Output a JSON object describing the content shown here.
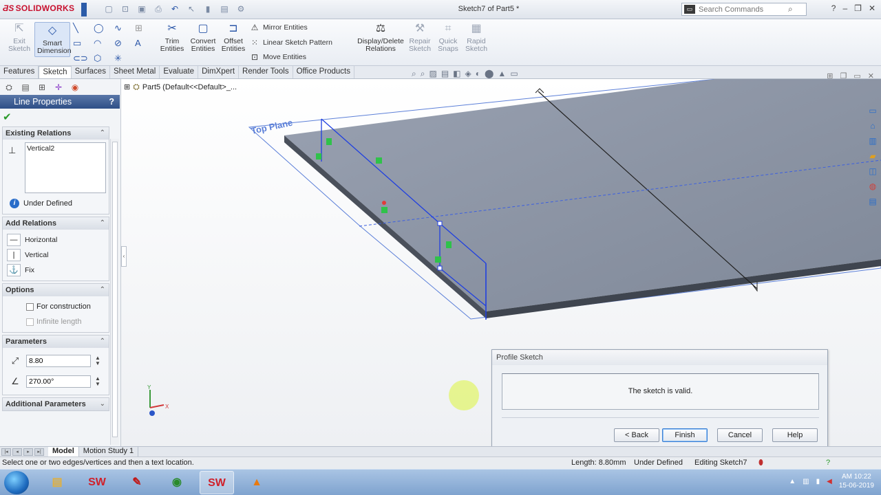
{
  "app": {
    "brand": "SOLIDWORKS",
    "document_title": "Sketch7 of Part5 *",
    "search_placeholder": "Search Commands",
    "colors": {
      "accent": "#2a56a8",
      "brand": "#c8102e",
      "sketch": "#1f3fe0",
      "plate": "#8d96a6"
    }
  },
  "toolbar": {
    "exit_sketch": "Exit Sketch",
    "smart_dimension": "Smart Dimension",
    "trim_entities": "Trim Entities",
    "convert_entities": "Convert Entities",
    "offset_entities": "Offset Entities",
    "mirror_entities": "Mirror Entities",
    "linear_sketch_pattern": "Linear Sketch Pattern",
    "move_entities": "Move Entities",
    "display_delete_relations": "Display/Delete Relations",
    "repair_sketch": "Repair Sketch",
    "quick_snaps": "Quick Snaps",
    "rapid_sketch": "Rapid Sketch"
  },
  "tabs": [
    "Features",
    "Sketch",
    "Surfaces",
    "Sheet Metal",
    "Evaluate",
    "DimXpert",
    "Render Tools",
    "Office Products"
  ],
  "active_tab": "Sketch",
  "tree": {
    "part_label": "Part5  (Default<<Default>_..."
  },
  "property_manager": {
    "title": "Line Properties",
    "help": "?",
    "existing_relations": {
      "heading": "Existing Relations",
      "items": [
        "Vertical2"
      ],
      "status": "Under Defined"
    },
    "add_relations": {
      "heading": "Add Relations",
      "items": [
        "Horizontal",
        "Vertical",
        "Fix"
      ]
    },
    "options": {
      "heading": "Options",
      "for_construction": "For construction",
      "infinite_length": "Infinite length"
    },
    "parameters": {
      "heading": "Parameters",
      "length": "8.80",
      "angle": "270.00°"
    },
    "additional_parameters": {
      "heading": "Additional Parameters"
    }
  },
  "viewport": {
    "plane_label": "Top Plane"
  },
  "dialog": {
    "title": "Profile Sketch",
    "message": "The sketch is valid.",
    "back": "< Back",
    "finish": "Finish",
    "cancel": "Cancel",
    "help": "Help"
  },
  "bottom_tabs": [
    "Model",
    "Motion Study 1"
  ],
  "status_bar": {
    "hint": "Select one or two edges/vertices and then a text location.",
    "length": "Length: 8.80mm",
    "definition": "Under Defined",
    "editing": "Editing Sketch7"
  },
  "taskbar": {
    "time": "AM 10:22",
    "date": "15-06-2019"
  }
}
